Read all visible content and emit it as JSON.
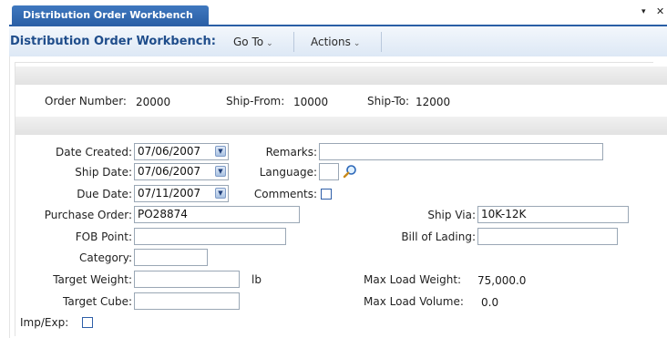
{
  "tab": {
    "label": "Distribution Order Workbench",
    "menu_glyph": "▾",
    "close_glyph": "✕"
  },
  "titlebar": {
    "title": "Distribution Order Workbench:",
    "menus": [
      {
        "label": "Go To",
        "chevron": "⌄"
      },
      {
        "label": "Actions",
        "chevron": "⌄"
      }
    ]
  },
  "header_info": {
    "order_number": {
      "label": "Order Number:",
      "value": "20000"
    },
    "ship_from": {
      "label": "Ship-From:",
      "value": "10000"
    },
    "ship_to": {
      "label": "Ship-To:",
      "value": "12000"
    }
  },
  "form": {
    "date_created": {
      "label": "Date Created:",
      "value": "07/06/2007"
    },
    "ship_date": {
      "label": "Ship Date:",
      "value": "07/06/2007"
    },
    "due_date": {
      "label": "Due Date:",
      "value": "07/11/2007"
    },
    "remarks": {
      "label": "Remarks:",
      "value": ""
    },
    "language": {
      "label": "Language:",
      "value": ""
    },
    "comments": {
      "label": "Comments:",
      "checked": false
    },
    "purchase_order": {
      "label": "Purchase Order:",
      "value": "PO28874"
    },
    "ship_via": {
      "label": "Ship Via:",
      "value": "10K-12K"
    },
    "fob_point": {
      "label": "FOB Point:",
      "value": ""
    },
    "bill_of_lading": {
      "label": "Bill of Lading:",
      "value": ""
    },
    "category": {
      "label": "Category:",
      "value": ""
    },
    "target_weight": {
      "label": "Target Weight:",
      "value": "",
      "unit": "lb"
    },
    "max_load_weight": {
      "label": "Max Load Weight:",
      "value": "75,000.0"
    },
    "target_cube": {
      "label": "Target Cube:",
      "value": ""
    },
    "max_load_volume": {
      "label": "Max Load Volume:",
      "value": "0.0"
    },
    "imp_exp": {
      "label": "Imp/Exp:",
      "checked": false
    }
  },
  "icons": {
    "dropdown": "▼",
    "lookup": "magnifier-icon"
  },
  "colors": {
    "accent": "#2a5fa6",
    "title_text": "#1f4d8b"
  }
}
